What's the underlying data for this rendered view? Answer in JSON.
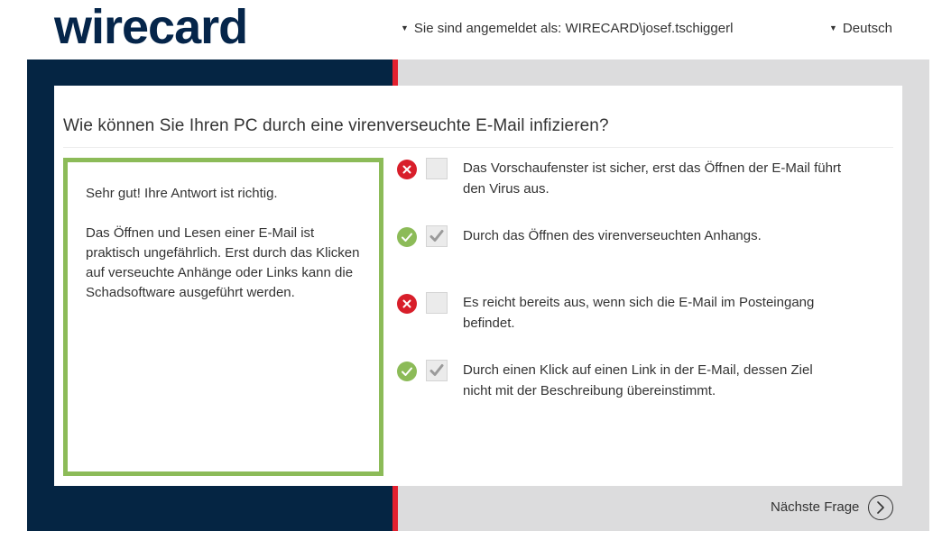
{
  "header": {
    "logo_text": "wirecard",
    "user_label": "Sie sind angemeldet als: WIRECARD\\josef.tschiggerl",
    "language_label": "Deutsch",
    "caret": "▼"
  },
  "colors": {
    "navy": "#052543",
    "red_accent": "#e3202e",
    "grey_panel": "#dcdcdd",
    "correct_green": "#8cbb58",
    "wrong_red": "#d81e2a"
  },
  "quiz": {
    "question": "Wie können Sie Ihren PC durch eine virenverseuchte E-Mail infizieren?",
    "feedback": {
      "title": "Sehr gut! Ihre Antwort ist richtig.",
      "body": "Das Öffnen und Lesen einer E-Mail ist praktisch ungefährlich. Erst durch das Klicken auf verseuchte Anhänge oder Links kann die Schadsoftware ausgeführt werden."
    },
    "answers": [
      {
        "text": "Das Vorschaufenster ist sicher, erst das Öffnen der E-Mail führt den Virus aus.",
        "status": "wrong",
        "checked": false,
        "status_icon": "cross-icon"
      },
      {
        "text": "Durch das Öffnen des virenverseuchten Anhangs.",
        "status": "correct",
        "checked": true,
        "status_icon": "check-icon"
      },
      {
        "text": "Es reicht bereits aus, wenn sich die E-Mail im Posteingang befindet.",
        "status": "wrong",
        "checked": false,
        "status_icon": "cross-icon"
      },
      {
        "text": "Durch einen Klick auf einen Link in der E-Mail, dessen Ziel nicht mit der Beschreibung übereinstimmt.",
        "status": "correct",
        "checked": true,
        "status_icon": "check-icon"
      }
    ]
  },
  "footer": {
    "next_label": "Nächste Frage",
    "next_icon": "chevron-right-circle-icon"
  }
}
